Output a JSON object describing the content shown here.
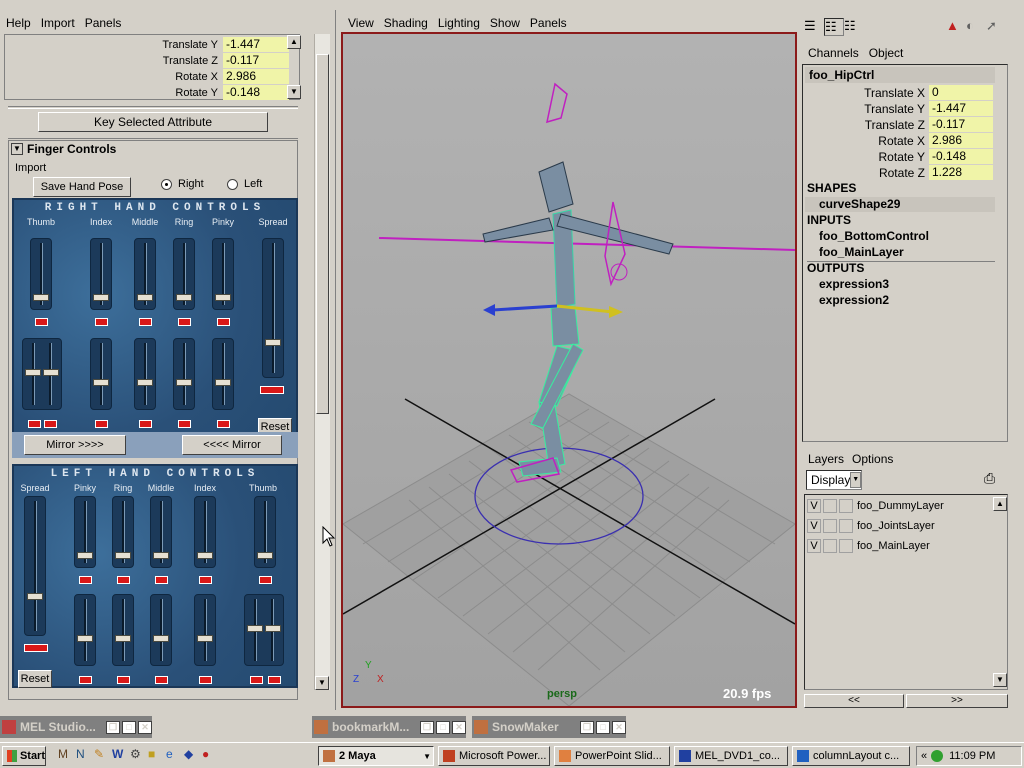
{
  "left_panel": {
    "menu": [
      "Help",
      "Import",
      "Panels"
    ],
    "attrs": [
      {
        "label": "Translate Y",
        "value": "-1.447"
      },
      {
        "label": "Translate Z",
        "value": "-0.117"
      },
      {
        "label": "Rotate X",
        "value": "2.986"
      },
      {
        "label": "Rotate Y",
        "value": "-0.148"
      }
    ],
    "key_selected_label": "Key Selected Attribute",
    "finger_title": "Finger Controls",
    "import_label": "Import",
    "save_pose_label": "Save Hand Pose",
    "radio_right": "Right",
    "radio_left": "Left",
    "right_title": "RIGHT HAND CONTROLS",
    "right_cols": [
      "Thumb",
      "Index",
      "Middle",
      "Ring",
      "Pinky",
      "Spread"
    ],
    "reset_label": "Reset",
    "mirror_right_label": "Mirror >>>>",
    "mirror_left_label": "<<<< Mirror",
    "left_title": "LEFT HAND CONTROLS",
    "left_cols": [
      "Spread",
      "Pinky",
      "Ring",
      "Middle",
      "Index",
      "Thumb"
    ]
  },
  "viewport": {
    "menu": [
      "View",
      "Shading",
      "Lighting",
      "Show",
      "Panels"
    ],
    "camera_label": "persp",
    "fps_label": "20.9 fps",
    "axis_y": "Y",
    "axis_z": "Z",
    "axis_x": "X"
  },
  "channel_box": {
    "tabs": [
      "Channels",
      "Object"
    ],
    "object_name": "foo_HipCtrl",
    "channels": [
      {
        "label": "Translate X",
        "value": "0"
      },
      {
        "label": "Translate Y",
        "value": "-1.447"
      },
      {
        "label": "Translate Z",
        "value": "-0.117"
      },
      {
        "label": "Rotate X",
        "value": "2.986"
      },
      {
        "label": "Rotate Y",
        "value": "-0.148"
      },
      {
        "label": "Rotate Z",
        "value": "1.228"
      }
    ],
    "shapes_header": "SHAPES",
    "shapes": [
      "curveShape29"
    ],
    "inputs_header": "INPUTS",
    "inputs": [
      "foo_BottomControl",
      "foo_MainLayer"
    ],
    "outputs_header": "OUTPUTS",
    "outputs": [
      "expression3",
      "expression2"
    ]
  },
  "layers": {
    "menu": [
      "Layers",
      "Options"
    ],
    "display_label": "Display",
    "items": [
      {
        "vis": "V",
        "name": "foo_DummyLayer"
      },
      {
        "vis": "V",
        "name": "foo_JointsLayer"
      },
      {
        "vis": "V",
        "name": "foo_MainLayer"
      }
    ],
    "nav_left": "<<",
    "nav_right": ">>"
  },
  "minimized": [
    {
      "title": "MEL Studio..."
    },
    {
      "title": "bookmarkM..."
    },
    {
      "title": "SnowMaker"
    }
  ],
  "taskbar": {
    "start_label": "Start",
    "tasks": [
      {
        "label": "2 Maya"
      },
      {
        "label": "Microsoft Power..."
      },
      {
        "label": "PowerPoint Slid..."
      },
      {
        "label": "MEL_DVD1_co..."
      },
      {
        "label": "columnLayout c..."
      }
    ],
    "tray_arrows": "«",
    "clock": "11:09 PM"
  }
}
